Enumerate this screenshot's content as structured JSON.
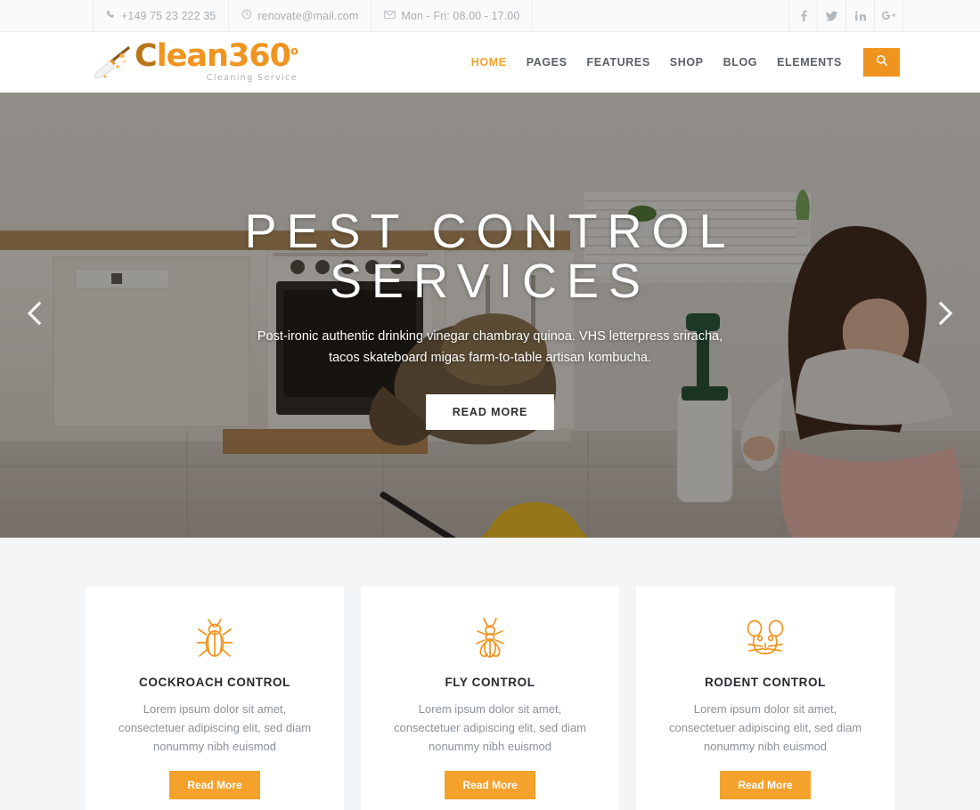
{
  "topbar": {
    "contacts": [
      {
        "icon": "phone-icon",
        "text": "+149 75 23 222 35"
      },
      {
        "icon": "clock-icon",
        "text": "renovate@mail.com"
      },
      {
        "icon": "envelope-icon",
        "text": "Mon - Fri: 08.00 - 17.00"
      }
    ],
    "social": [
      {
        "icon": "facebook-icon",
        "label": "f"
      },
      {
        "icon": "twitter-icon",
        "label": "t"
      },
      {
        "icon": "linkedin-icon",
        "label": "in"
      },
      {
        "icon": "google-plus-icon",
        "label": "G+"
      }
    ]
  },
  "header": {
    "logo": {
      "text_light": "C",
      "text_main": "lean360",
      "degree": "o",
      "tagline": "Cleaning Service",
      "icon": "broom-icon"
    },
    "nav": [
      {
        "label": "HOME",
        "active": true
      },
      {
        "label": "PAGES",
        "active": false
      },
      {
        "label": "FEATURES",
        "active": false
      },
      {
        "label": "SHOP",
        "active": false
      },
      {
        "label": "BLOG",
        "active": false
      },
      {
        "label": "ELEMENTS",
        "active": false
      }
    ],
    "search_icon": "search-icon"
  },
  "hero": {
    "title": "PEST CONTROL SERVICES",
    "subtitle": "Post-ironic authentic drinking vinegar chambray quinoa. VHS letterpress sriracha, tacos skateboard migas farm-to-table artisan kombucha.",
    "button": "READ MORE",
    "prev_icon": "chevron-left-icon",
    "next_icon": "chevron-right-icon"
  },
  "services": {
    "cards": [
      {
        "icon": "cockroach-icon",
        "title": "COCKROACH CONTROL",
        "desc": "Lorem ipsum dolor sit amet, consectetuer adipiscing elit, sed diam nonummy nibh euismod",
        "button": "Read More"
      },
      {
        "icon": "fly-icon",
        "title": "FLY CONTROL",
        "desc": "Lorem ipsum dolor sit amet, consectetuer adipiscing elit, sed diam nonummy nibh euismod",
        "button": "Read More"
      },
      {
        "icon": "rodent-icon",
        "title": "RODENT CONTROL",
        "desc": "Lorem ipsum dolor sit amet, consectetuer adipiscing elit, sed diam nonummy nibh euismod",
        "button": "Read More"
      }
    ]
  },
  "colors": {
    "accent": "#f0941f",
    "accent_light": "#f5a22c",
    "topbar_bg": "#fafafa",
    "section_bg": "#f4f5f7",
    "text_muted": "#8b9199",
    "nav_text": "#5a5f66"
  }
}
